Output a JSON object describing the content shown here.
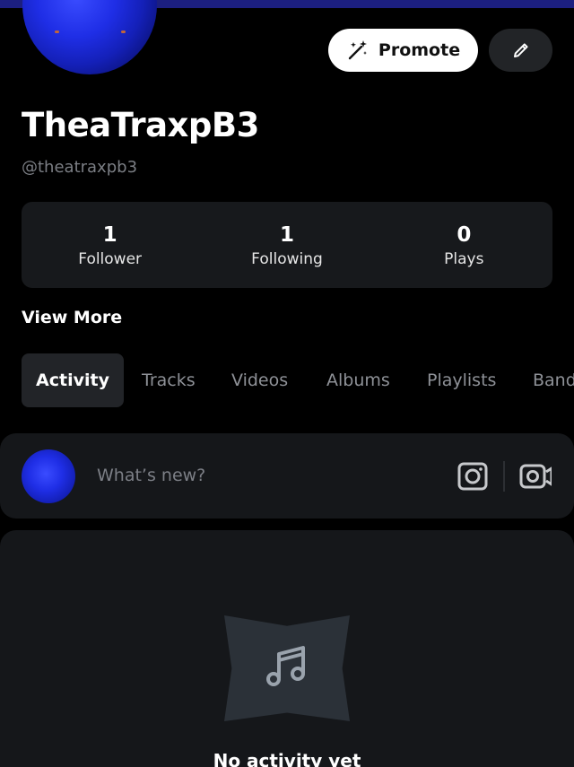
{
  "profile": {
    "display_name": "TheaTraxpB3",
    "handle": "@theatraxpb3"
  },
  "actions": {
    "promote_label": "Promote",
    "promote_icon": "sparkle-wand-icon",
    "edit_icon": "pencil-icon"
  },
  "stats": [
    {
      "value": "1",
      "label": "Follower"
    },
    {
      "value": "1",
      "label": "Following"
    },
    {
      "value": "0",
      "label": "Plays"
    }
  ],
  "view_more_label": "View More",
  "tabs": [
    {
      "label": "Activity",
      "active": true
    },
    {
      "label": "Tracks",
      "active": false
    },
    {
      "label": "Videos",
      "active": false
    },
    {
      "label": "Albums",
      "active": false
    },
    {
      "label": "Playlists",
      "active": false
    },
    {
      "label": "Band",
      "active": false
    }
  ],
  "composer": {
    "placeholder": "What’s new?",
    "photo_icon": "camera-icon",
    "video_icon": "video-camera-icon"
  },
  "empty_state": {
    "icon": "music-note-icon",
    "text": "No activity yet"
  },
  "colors": {
    "background": "#000000",
    "card": "#17191c",
    "top_accent": "#1c1f80",
    "muted_text": "#7b7e84"
  }
}
